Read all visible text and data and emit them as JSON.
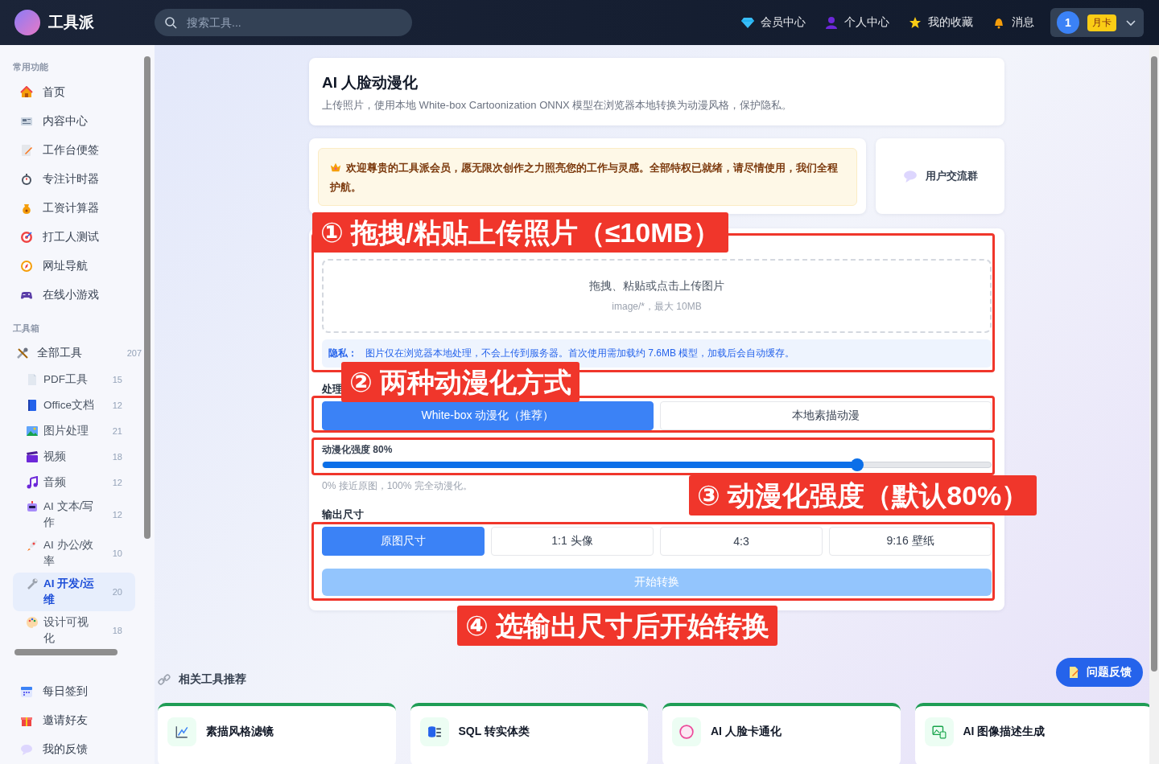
{
  "header": {
    "logo": "工具派",
    "search": {
      "placeholder": "搜索工具..."
    },
    "nav": [
      {
        "label": "会员中心"
      },
      {
        "label": "个人中心"
      },
      {
        "label": "我的收藏"
      },
      {
        "label": "消息"
      }
    ],
    "user": {
      "avatar": "1",
      "badge": "月卡"
    }
  },
  "sidebar": {
    "sections": [
      {
        "title": "常用功能",
        "items": [
          {
            "label": "首页",
            "selected": false
          },
          {
            "label": "内容中心",
            "selected": false
          },
          {
            "label": "工作台便签",
            "selected": false
          },
          {
            "label": "专注计时器",
            "selected": false
          },
          {
            "label": "工资计算器",
            "selected": false
          },
          {
            "label": "打工人测试",
            "selected": false
          },
          {
            "label": "网址导航",
            "selected": false
          },
          {
            "label": "在线小游戏",
            "selected": false
          }
        ]
      },
      {
        "title": "工具箱",
        "items": [
          {
            "label": "全部工具",
            "count": "207",
            "selected": false,
            "children": [
              {
                "label": "PDF工具",
                "count": "15",
                "selected": false
              },
              {
                "label": "Office文档",
                "count": "12",
                "selected": false
              },
              {
                "label": "图片处理",
                "count": "21",
                "selected": false
              },
              {
                "label": "视频",
                "count": "18",
                "selected": false
              },
              {
                "label": "音频",
                "count": "12",
                "selected": false
              },
              {
                "label": "AI 文本/写作",
                "count": "12",
                "selected": false
              },
              {
                "label": "AI 办公/效率",
                "count": "10",
                "selected": false
              },
              {
                "label": "AI 开发/运维",
                "count": "20",
                "selected": true
              },
              {
                "label": "设计可视化",
                "count": "18",
                "selected": false
              }
            ]
          }
        ]
      }
    ],
    "footer_items": [
      {
        "label": "每日签到"
      },
      {
        "label": "邀请好友"
      },
      {
        "label": "我的反馈"
      }
    ]
  },
  "page": {
    "title": "AI 人脸动漫化",
    "subtitle": "上传照片，使用本地 White-box Cartoonization ONNX 模型在浏览器本地转换为动漫风格，保护隐私。"
  },
  "notice": {
    "text": "欢迎尊贵的工具派会员，愿无限次创作之力照亮您的工作与灵感。全部特权已就绪，请尽情使用，我们全程护航。"
  },
  "group_link": {
    "label": "用户交流群"
  },
  "upload": {
    "prompt": "拖拽、粘贴或点击上传图片",
    "hint": "image/*，最大 10MB",
    "privacy_label": "隐私：",
    "privacy_text": "图片仅在浏览器本地处理，不会上传到服务器。首次使用需加载约 7.6MB 模型，加载后会自动缓存。"
  },
  "mode": {
    "label": "处理",
    "options": [
      {
        "label": "White-box 动漫化（推荐）",
        "selected": true
      },
      {
        "label": "本地素描动漫",
        "selected": false
      }
    ]
  },
  "strength": {
    "label": "动漫化强度 80%",
    "level": 0.8,
    "hint": "0% 接近原图，100% 完全动漫化。"
  },
  "output": {
    "label": "输出尺寸",
    "options": [
      {
        "label": "原图尺寸",
        "selected": true
      },
      {
        "label": "1:1 头像",
        "selected": false
      },
      {
        "label": "4:3",
        "selected": false
      },
      {
        "label": "9:16 壁纸",
        "selected": false
      }
    ]
  },
  "start_button": {
    "label": "开始转换",
    "disabled": true
  },
  "related": {
    "title": "相关工具推荐",
    "tools": [
      {
        "name": "素描风格滤镜"
      },
      {
        "name": "SQL 转实体类"
      },
      {
        "name": "AI 人脸卡通化"
      },
      {
        "name": "AI 图像描述生成"
      }
    ]
  },
  "feedback_button": {
    "label": "问题反馈"
  },
  "annotations": [
    {
      "text": "① 拖拽/粘贴上传照片（≤10MB）"
    },
    {
      "text": "② 两种动漫化方式"
    },
    {
      "text": "③ 动漫化强度（默认80%）"
    },
    {
      "text": "④ 选输出尺寸后开始转换"
    }
  ]
}
